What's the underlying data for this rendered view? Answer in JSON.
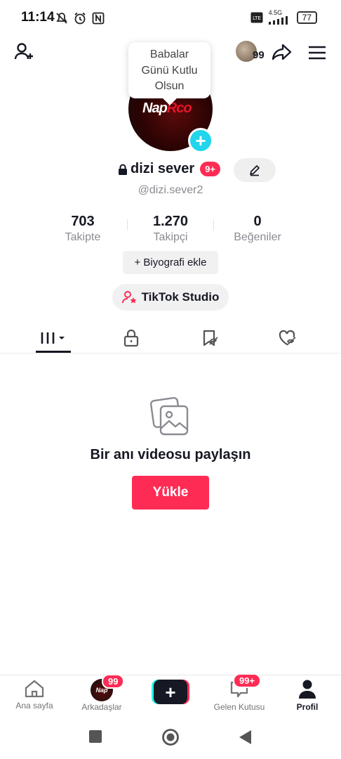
{
  "status_bar": {
    "time": "11:14",
    "network": "4.5G",
    "battery": "77"
  },
  "header": {
    "avatar_badge": "99"
  },
  "tooltip": {
    "line1": "Babalar",
    "line2": "Günü Kutlu",
    "line3": "Olsun"
  },
  "avatar": {
    "text_white": "Nap",
    "text_red": "Rco"
  },
  "profile": {
    "username": "dizi sever",
    "badge": "9+",
    "handle": "@dizi.sever2",
    "stats": [
      {
        "value": "703",
        "label": "Takipte"
      },
      {
        "value": "1.270",
        "label": "Takipçi"
      },
      {
        "value": "0",
        "label": "Beğeniler"
      }
    ],
    "bio_button": "+ Biyografi ekle",
    "studio_button": "TikTok Studio"
  },
  "empty_state": {
    "title": "Bir anı videosu paylaşın",
    "upload_button": "Yükle"
  },
  "bottom_nav": {
    "items": [
      {
        "label": "Ana sayfa"
      },
      {
        "label": "Arkadaşlar",
        "badge": "99",
        "avatar_text": "Nap"
      },
      {
        "label": ""
      },
      {
        "label": "Gelen Kutusu",
        "badge": "99+"
      },
      {
        "label": "Profil"
      }
    ]
  },
  "colors": {
    "accent_red": "#fe2c55",
    "accent_cyan": "#20d5ec",
    "text_dark": "#161823",
    "text_gray": "#8a8b91"
  }
}
